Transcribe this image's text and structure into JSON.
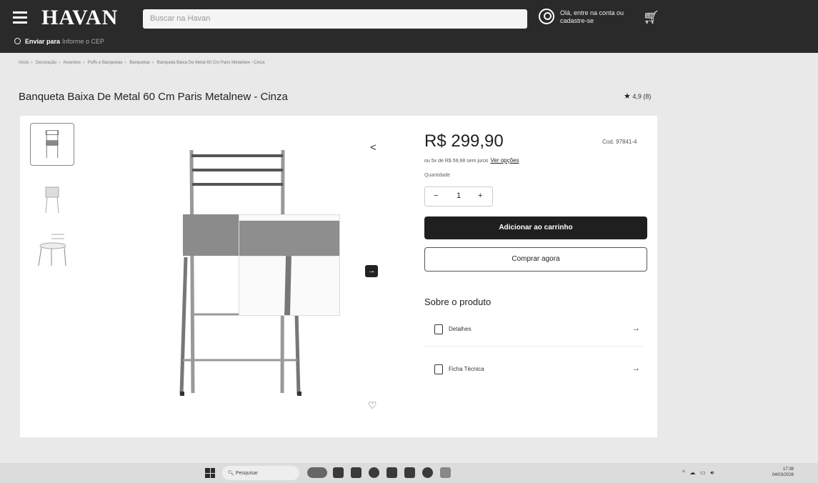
{
  "header": {
    "logo": "HAVAN",
    "search_placeholder": "Buscar na Havan",
    "login_text": "Olá, entre na conta ou cadastre-se",
    "deliver_label": "Enviar para",
    "deliver_value": "Informe o CEP"
  },
  "breadcrumb": [
    "Início",
    "Decoração",
    "Assentos",
    "Puffs e Banquetas",
    "Banquetas",
    "Banqueta Baixa De Metal 60 Cm Paris Metalnew - Cinza"
  ],
  "product": {
    "title": "Banqueta Baixa De Metal 60 Cm Paris Metalnew - Cinza",
    "rating": "4,9",
    "rating_count": "(8)",
    "price": "R$ 299,90",
    "sku": "Cod. 97841-4",
    "installments": "ou 5x de R$ 59,98 sem juros",
    "installments_link": "Ver opções",
    "quantity_label": "Quantidade",
    "quantity": "1",
    "add_to_cart": "Adicionar ao carrinho",
    "buy_now": "Comprar agora",
    "about_title": "Sobre o produto",
    "details": [
      {
        "label": "Detalhes"
      },
      {
        "label": "Ficha Técnica"
      }
    ]
  },
  "taskbar": {
    "search_placeholder": "Pesquisar",
    "time": "17:38",
    "date": "04/03/2026"
  },
  "icons": {
    "menu": "hamburger-icon",
    "user": "user-icon",
    "cart": "cart-icon",
    "share": "share-icon",
    "next": "arrow-right-icon",
    "favorite": "heart-icon"
  },
  "colors": {
    "header_bg": "#2a2a2a",
    "primary_button": "#1f1f1f"
  }
}
